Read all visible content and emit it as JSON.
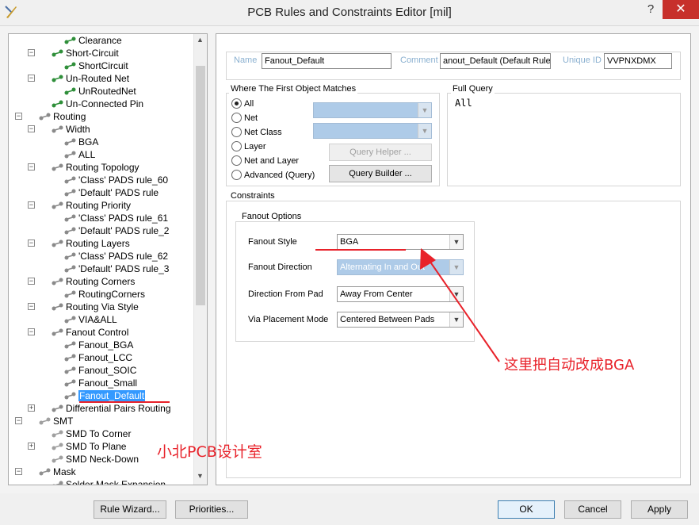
{
  "window": {
    "title": "PCB Rules and Constraints Editor [mil]",
    "help": "?",
    "close": "✕"
  },
  "tree": [
    {
      "label": "Clearance",
      "level": 4,
      "icon": "rule-icon",
      "exp": ""
    },
    {
      "label": "Short-Circuit",
      "level": 3,
      "icon": "rule-icon",
      "exp": "−"
    },
    {
      "label": "ShortCircuit",
      "level": 4,
      "icon": "rule-icon",
      "exp": ""
    },
    {
      "label": "Un-Routed Net",
      "level": 3,
      "icon": "rule-icon",
      "exp": "−"
    },
    {
      "label": "UnRoutedNet",
      "level": 4,
      "icon": "rule-icon",
      "exp": ""
    },
    {
      "label": "Un-Connected Pin",
      "level": 3,
      "icon": "rule-icon",
      "exp": ""
    },
    {
      "label": "Routing",
      "level": 2,
      "icon": "routing-icon",
      "exp": "−"
    },
    {
      "label": "Width",
      "level": 3,
      "icon": "routing-icon",
      "exp": "−"
    },
    {
      "label": "BGA",
      "level": 4,
      "icon": "routing-icon",
      "exp": ""
    },
    {
      "label": "ALL",
      "level": 4,
      "icon": "routing-icon",
      "exp": ""
    },
    {
      "label": "Routing Topology",
      "level": 3,
      "icon": "routing-icon",
      "exp": "−"
    },
    {
      "label": "'Class' PADS rule_60",
      "level": 4,
      "icon": "routing-icon",
      "exp": ""
    },
    {
      "label": "'Default' PADS rule",
      "level": 4,
      "icon": "routing-icon",
      "exp": ""
    },
    {
      "label": "Routing Priority",
      "level": 3,
      "icon": "routing-icon",
      "exp": "−"
    },
    {
      "label": "'Class' PADS rule_61",
      "level": 4,
      "icon": "routing-icon",
      "exp": ""
    },
    {
      "label": "'Default' PADS rule_2",
      "level": 4,
      "icon": "routing-icon",
      "exp": ""
    },
    {
      "label": "Routing Layers",
      "level": 3,
      "icon": "routing-icon",
      "exp": "−"
    },
    {
      "label": "'Class' PADS rule_62",
      "level": 4,
      "icon": "routing-icon",
      "exp": ""
    },
    {
      "label": "'Default' PADS rule_3",
      "level": 4,
      "icon": "routing-icon",
      "exp": ""
    },
    {
      "label": "Routing Corners",
      "level": 3,
      "icon": "routing-icon",
      "exp": "−"
    },
    {
      "label": "RoutingCorners",
      "level": 4,
      "icon": "routing-icon",
      "exp": ""
    },
    {
      "label": "Routing Via Style",
      "level": 3,
      "icon": "routing-icon",
      "exp": "−"
    },
    {
      "label": "VIA&ALL",
      "level": 4,
      "icon": "routing-icon",
      "exp": ""
    },
    {
      "label": "Fanout Control",
      "level": 3,
      "icon": "routing-icon",
      "exp": "−"
    },
    {
      "label": "Fanout_BGA",
      "level": 4,
      "icon": "routing-icon",
      "exp": ""
    },
    {
      "label": "Fanout_LCC",
      "level": 4,
      "icon": "routing-icon",
      "exp": ""
    },
    {
      "label": "Fanout_SOIC",
      "level": 4,
      "icon": "routing-icon",
      "exp": ""
    },
    {
      "label": "Fanout_Small",
      "level": 4,
      "icon": "routing-icon",
      "exp": ""
    },
    {
      "label": "Fanout_Default",
      "level": 4,
      "icon": "routing-icon",
      "exp": "",
      "selected": true
    },
    {
      "label": "Differential Pairs Routing",
      "level": 3,
      "icon": "routing-icon",
      "exp": "+"
    },
    {
      "label": "SMT",
      "level": 2,
      "icon": "smt-icon",
      "exp": "−"
    },
    {
      "label": "SMD To Corner",
      "level": 3,
      "icon": "smt-icon",
      "exp": ""
    },
    {
      "label": "SMD To Plane",
      "level": 3,
      "icon": "smt-icon",
      "exp": "+"
    },
    {
      "label": "SMD Neck-Down",
      "level": 3,
      "icon": "smt-icon",
      "exp": ""
    },
    {
      "label": "Mask",
      "level": 2,
      "icon": "mask-icon",
      "exp": "−"
    },
    {
      "label": "Solder Mask Expansion",
      "level": 3,
      "icon": "mask-icon",
      "exp": ""
    }
  ],
  "header": {
    "name_label": "Name",
    "name_value": "Fanout_Default",
    "comment_label": "Comment",
    "comment_value": "anout_Default (Default Rule)",
    "uid_label": "Unique ID",
    "uid_value": "VVPNXDMX"
  },
  "match": {
    "title": "Where The First Object Matches",
    "options": [
      "All",
      "Net",
      "Net Class",
      "Layer",
      "Net and Layer",
      "Advanced (Query)"
    ],
    "selected": "All",
    "query_helper": "Query Helper ...",
    "query_builder": "Query Builder ..."
  },
  "full_query": {
    "title": "Full Query",
    "text": "All"
  },
  "constraints": {
    "title": "Constraints",
    "fanout_title": "Fanout Options",
    "style_label": "Fanout Style",
    "style_value": "BGA",
    "direction_label": "Fanout Direction",
    "direction_value": "Alternating In and Out",
    "from_pad_label": "Direction From Pad",
    "from_pad_value": "Away From Center",
    "via_label": "Via Placement Mode",
    "via_value": "Centered Between Pads"
  },
  "annotation": {
    "note": "这里把自动改成BGA",
    "watermark": "小北PCB设计室",
    "color": "#e8222a"
  },
  "footer": {
    "rule_wizard": "Rule Wizard...",
    "priorities": "Priorities...",
    "ok": "OK",
    "cancel": "Cancel",
    "apply": "Apply"
  }
}
